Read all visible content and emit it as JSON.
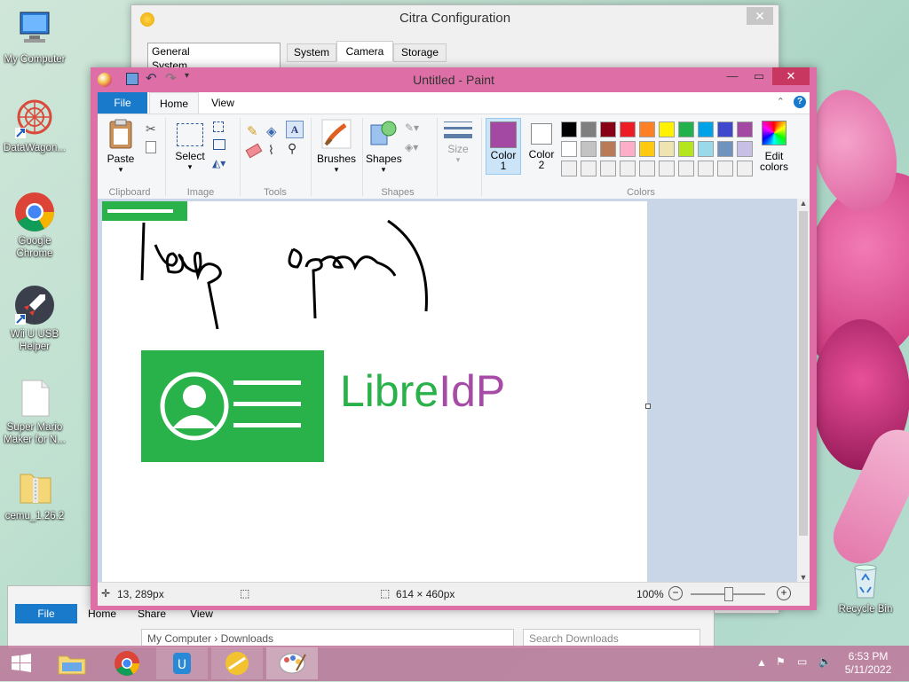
{
  "desktop": {
    "icons": [
      {
        "label": "My Computer"
      },
      {
        "label": "DataWagon..."
      },
      {
        "label": "Google Chrome"
      },
      {
        "label": "Wii U USB Helper"
      },
      {
        "label": "Super Mario Maker for N..."
      },
      {
        "label": "cemu_1.26.2"
      },
      {
        "label": "Recycle Bin"
      }
    ]
  },
  "citra": {
    "title": "Citra Configuration",
    "sidebar": [
      "General",
      "System"
    ],
    "tabs": [
      "System",
      "Camera",
      "Storage"
    ]
  },
  "paint": {
    "title": "Untitled - Paint",
    "tabs": {
      "file": "File",
      "home": "Home",
      "view": "View"
    },
    "groups": {
      "clipboard": "Clipboard",
      "image": "Image",
      "tools": "Tools",
      "shapes": "Shapes",
      "colors": "Colors"
    },
    "buttons": {
      "paste": "Paste",
      "select": "Select",
      "brushes": "Brushes",
      "shapes": "Shapes",
      "size": "Size",
      "color1": "Color\n1",
      "color1_a": "Color",
      "color1_b": "1",
      "color2_a": "Color",
      "color2_b": "2",
      "edit_colors_a": "Edit",
      "edit_colors_b": "colors"
    },
    "palette_row1": [
      "#000000",
      "#7f7f7f",
      "#880015",
      "#ed1c24",
      "#ff7f27",
      "#fff200",
      "#22b14c",
      "#00a2e8",
      "#3f48cc",
      "#a349a4"
    ],
    "palette_row2": [
      "#ffffff",
      "#c3c3c3",
      "#b97a57",
      "#ffaec9",
      "#ffc90e",
      "#efe4b0",
      "#b5e61d",
      "#99d9ea",
      "#7092be",
      "#c8bfe7"
    ],
    "color1_value": "#a349a4",
    "color2_value": "#ffffff",
    "canvas": {
      "handwriting_1": "keep",
      "handwriting_2": "open)",
      "logo_text_a": "Libre",
      "logo_text_b": "IdP",
      "logo_green": "#2ab24a",
      "logo_purple": "#a64ca6"
    },
    "status": {
      "cursor": "13, 289px",
      "dimensions": "614 × 460px",
      "zoom": "100%"
    }
  },
  "explorer": {
    "tabs": [
      "File",
      "Home",
      "Share",
      "View"
    ],
    "address": "My Computer › Downloads",
    "search_placeholder": "Search Downloads"
  },
  "taskbar": {
    "time": "6:53 PM",
    "date": "5/11/2022"
  }
}
